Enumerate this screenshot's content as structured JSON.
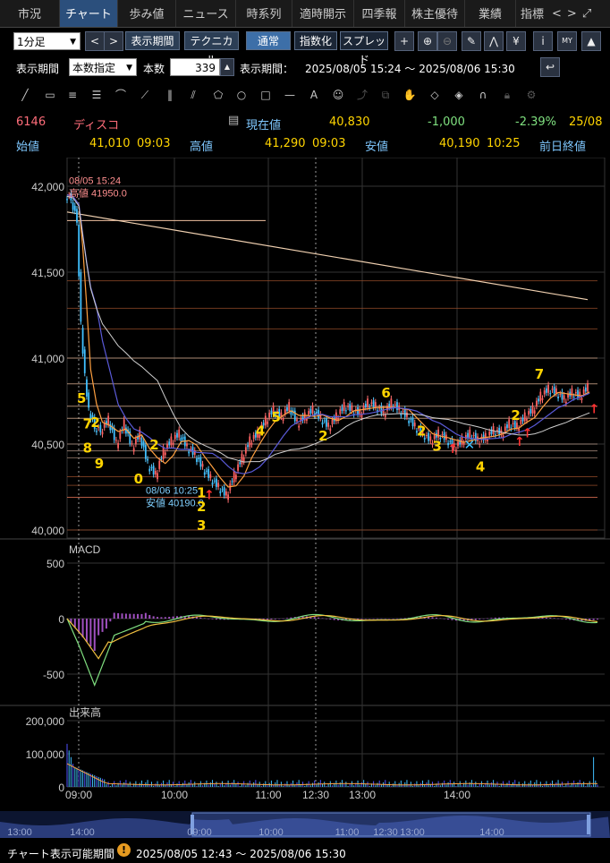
{
  "tabs": [
    "市況",
    "チャート",
    "歩み値",
    "ニュース",
    "時系列",
    "適時開示",
    "四季報",
    "株主優待",
    "業績",
    "指標"
  ],
  "tab_nav": {
    "prev": "<",
    "next": ">",
    "expand": "⤢"
  },
  "toolbar1": {
    "interval": "1分足",
    "prev": "<",
    "next": ">",
    "period_button": "表示期間",
    "technical_button": "テクニカル",
    "normal_button": "通常",
    "index_button": "指数化",
    "spread_button": "スプレッド"
  },
  "toolbar2": {
    "period_label": "表示期間",
    "period_select": "本数指定",
    "count_label": "本数",
    "count_value": "339",
    "range_label": "表示期間：",
    "range_value": "2025/08/05 15:24 〜 2025/08/06 15:30"
  },
  "drawing_tools": [
    "line-tool",
    "ruler-tool",
    "hlines-tool",
    "hlines2-tool",
    "fan-tool",
    "arc-tool",
    "vlines-tool",
    "fan2-tool",
    "pentagon-tool",
    "circle-tool",
    "rect-tool",
    "hline-tool",
    "text-tool",
    "icon-tool",
    "pointer-tool",
    "copy-tool",
    "hand-tool",
    "eraser-tool",
    "eraser-all-tool",
    "magnet-tool",
    "lock-tool",
    "settings-tool"
  ],
  "quote": {
    "code": "6146",
    "name": "ディスコ",
    "current_label": "現在値",
    "current_value": "40,830",
    "change": "-1,000",
    "change_pct": "-2.39%",
    "date": "25/08",
    "open_label": "始値",
    "open_value": "41,010",
    "open_time": "09:03",
    "high_label": "高値",
    "high_value": "41,290",
    "high_time": "09:03",
    "low_label": "安値",
    "low_value": "40,190",
    "low_time": "10:25",
    "prev_close_label": "前日終値"
  },
  "colors": {
    "up": "#ff6060",
    "down": "#40c0ff",
    "label_yellow": "#ffd400",
    "macd": "#a050c0",
    "bg": "#000000"
  },
  "chart_data": {
    "type": "candlestick",
    "price_ticks": [
      "42,000",
      "41,500",
      "41,000",
      "40,500",
      "40,000"
    ],
    "macd_label": "MACD",
    "macd_ticks": [
      "500",
      "0",
      "-500"
    ],
    "volume_label": "出来高",
    "volume_ticks": [
      "200,000",
      "100,000",
      "0"
    ],
    "time_ticks": [
      "09:00",
      "10:00",
      "11:00",
      "12:30",
      "13:00",
      "14:00"
    ],
    "high_annotation": [
      "08/05 15:24",
      "高値 41950.0"
    ],
    "low_annotation": [
      "08/06 10:25",
      "安値 40190.0"
    ],
    "price_path": [
      [
        0,
        41950
      ],
      [
        3,
        41930
      ],
      [
        6,
        41800
      ],
      [
        8,
        41200
      ],
      [
        10,
        40900
      ],
      [
        12,
        40700
      ],
      [
        15,
        40600
      ],
      [
        18,
        40580
      ],
      [
        22,
        40640
      ],
      [
        26,
        40500
      ],
      [
        30,
        40620
      ],
      [
        34,
        40480
      ],
      [
        38,
        40560
      ],
      [
        42,
        40380
      ],
      [
        46,
        40320
      ],
      [
        50,
        40460
      ],
      [
        54,
        40520
      ],
      [
        58,
        40560
      ],
      [
        62,
        40480
      ],
      [
        66,
        40440
      ],
      [
        70,
        40360
      ],
      [
        74,
        40300
      ],
      [
        78,
        40250
      ],
      [
        82,
        40200
      ],
      [
        86,
        40320
      ],
      [
        90,
        40420
      ],
      [
        94,
        40520
      ],
      [
        98,
        40560
      ],
      [
        102,
        40640
      ],
      [
        106,
        40700
      ],
      [
        110,
        40660
      ],
      [
        114,
        40720
      ],
      [
        118,
        40620
      ],
      [
        122,
        40660
      ],
      [
        126,
        40700
      ],
      [
        130,
        40650
      ],
      [
        134,
        40600
      ],
      [
        138,
        40660
      ],
      [
        142,
        40720
      ],
      [
        146,
        40700
      ],
      [
        150,
        40680
      ],
      [
        154,
        40740
      ],
      [
        158,
        40720
      ],
      [
        162,
        40680
      ],
      [
        166,
        40740
      ],
      [
        170,
        40700
      ],
      [
        174,
        40660
      ],
      [
        178,
        40600
      ],
      [
        182,
        40560
      ],
      [
        186,
        40520
      ],
      [
        190,
        40560
      ],
      [
        194,
        40530
      ],
      [
        198,
        40480
      ],
      [
        202,
        40520
      ],
      [
        206,
        40560
      ],
      [
        210,
        40520
      ],
      [
        214,
        40540
      ],
      [
        218,
        40580
      ],
      [
        222,
        40560
      ],
      [
        226,
        40620
      ],
      [
        230,
        40600
      ],
      [
        234,
        40660
      ],
      [
        238,
        40700
      ],
      [
        242,
        40780
      ],
      [
        246,
        40820
      ],
      [
        250,
        40800
      ],
      [
        254,
        40760
      ],
      [
        258,
        40800
      ],
      [
        262,
        40780
      ],
      [
        266,
        40830
      ]
    ],
    "wave_labels": [
      {
        "text": "5",
        "i": 5,
        "p": 40740
      },
      {
        "text": "7",
        "i": 8,
        "p": 40590
      },
      {
        "text": "2",
        "i": 12,
        "p": 40600
      },
      {
        "text": "8",
        "i": 8,
        "p": 40450
      },
      {
        "text": "9",
        "i": 14,
        "p": 40360
      },
      {
        "text": "0",
        "i": 34,
        "p": 40270
      },
      {
        "text": "2",
        "i": 42,
        "p": 40470
      },
      {
        "text": "1",
        "i": 66,
        "p": 40190
      },
      {
        "text": "2",
        "i": 66,
        "p": 40110
      },
      {
        "text": "3",
        "i": 66,
        "p": 40000
      },
      {
        "text": "4",
        "i": 96,
        "p": 40550
      },
      {
        "text": "5",
        "i": 104,
        "p": 40630
      },
      {
        "text": "2",
        "i": 128,
        "p": 40520
      },
      {
        "text": "6",
        "i": 160,
        "p": 40770
      },
      {
        "text": "2",
        "i": 178,
        "p": 40550
      },
      {
        "text": "3",
        "i": 186,
        "p": 40460
      },
      {
        "text": "4",
        "i": 208,
        "p": 40340
      },
      {
        "text": "2",
        "i": 226,
        "p": 40640
      },
      {
        "text": "7",
        "i": 238,
        "p": 40880
      }
    ]
  },
  "bottom_timeline": {
    "ticks": [
      "13:00",
      "14:00",
      "09:00",
      "10:00",
      "11:00",
      "12:30",
      "13:00",
      "14:00"
    ]
  },
  "footer": {
    "label": "チャート表示可能期間",
    "range": "2025/08/05 12:43 〜 2025/08/06 15:30"
  }
}
